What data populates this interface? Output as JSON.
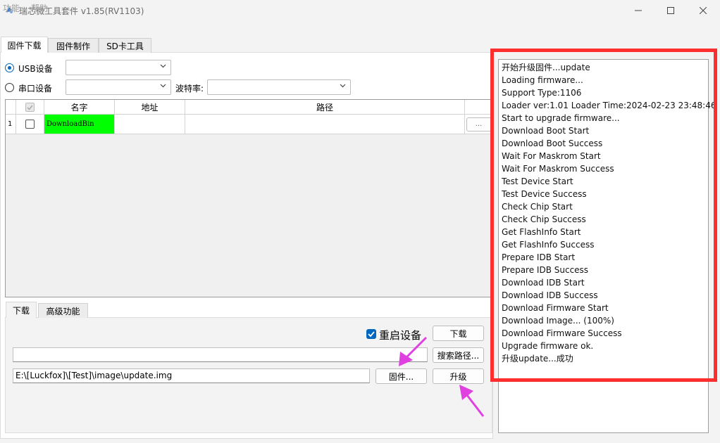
{
  "window": {
    "title": "瑞芯微工具套件 v1.85(RV1103)"
  },
  "menu": {
    "function": "功能",
    "help": "帮助"
  },
  "tabs": {
    "download": "固件下载",
    "make": "固件制作",
    "sd": "SD卡工具"
  },
  "device": {
    "usb_label": "USB设备",
    "usb_value": "",
    "serial_label": "串口设备",
    "serial_value": "",
    "baud_label": "波特率:",
    "baud_value": ""
  },
  "grid": {
    "col_name": "名字",
    "col_addr": "地址",
    "col_path": "路径",
    "rows": [
      {
        "index": "1",
        "name": "DownloadBin",
        "addr": "",
        "path": "",
        "browse": "..."
      }
    ]
  },
  "lower_tabs": {
    "download": "下载",
    "advanced": "高级功能"
  },
  "actions": {
    "reboot_label": "重启设备",
    "download_button": "下载",
    "search_path_value": "",
    "search_path_button": "搜索路径...",
    "firmware_path": "E:\\[Luckfox]\\[Test]\\image\\update.img",
    "firmware_button": "固件...",
    "upgrade_button": "升级"
  },
  "log": [
    "开始升级固件...update",
    "Loading firmware...",
    "Support Type:1106",
    "Loader ver:1.01 Loader Time:2024-02-23 23:48:46",
    "Start to upgrade firmware...",
    "Download Boot Start",
    "Download Boot Success",
    "Wait For Maskrom Start",
    "Wait For Maskrom Success",
    "Test Device Start",
    "Test Device Success",
    "Check Chip Start",
    "Check Chip Success",
    "Get FlashInfo Start",
    "Get FlashInfo Success",
    "Prepare IDB Start",
    "Prepare IDB Success",
    "Download IDB Start",
    "Download IDB Success",
    "Download Firmware Start",
    "Download Image... (100%)",
    "Download Firmware Success",
    "Upgrade firmware ok.",
    "升级update...成功"
  ],
  "colors": {
    "highlight_frame": "#ff2e2e",
    "arrow": "#e040e0",
    "name_cell_bg": "#00ff00",
    "accent": "#0067c0"
  }
}
